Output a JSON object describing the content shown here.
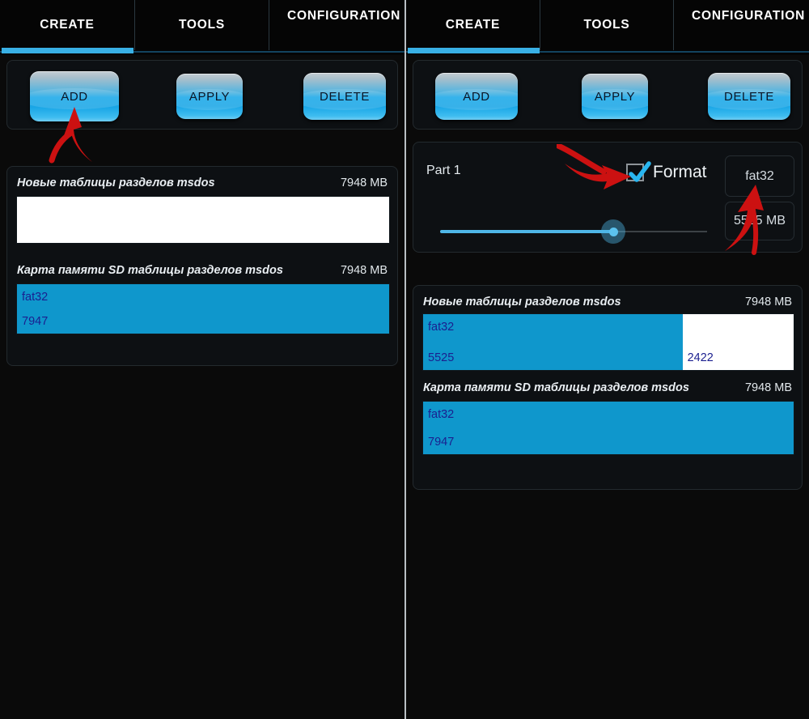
{
  "app": {
    "accent_blue": "#39b0e5",
    "bar_blue": "#0f97cc",
    "free_white": "#ffffff",
    "arrow_red": "#cc1111"
  },
  "tabs": [
    {
      "id": "create",
      "label": "CREATE",
      "active": true
    },
    {
      "id": "tools",
      "label": "TOOLS",
      "active": false
    },
    {
      "id": "configuration",
      "label": "CONFIGURATION",
      "active": false
    }
  ],
  "toolbar": {
    "add_label": "ADD",
    "apply_label": "APPLY",
    "delete_label": "DELETE"
  },
  "left_panel": {
    "devices": [
      {
        "name": "Новые таблицы разделов msdos",
        "size": "7948 MB",
        "segments": [
          {
            "type": "free",
            "fs": "",
            "mb": "",
            "percent": 100
          }
        ]
      },
      {
        "name": "Карта памяти SD таблицы разделов msdos",
        "size": "7948 MB",
        "segments": [
          {
            "type": "used",
            "fs": "fat32",
            "mb": "7947",
            "percent": 100
          }
        ]
      }
    ]
  },
  "right_panel": {
    "part_editor": {
      "title": "Part 1",
      "format_label": "Format",
      "format_checked": true,
      "filesystem": "fat32",
      "size_value": "5525 MB",
      "slider_percent": 65
    },
    "devices": [
      {
        "name": "Новые таблицы разделов msdos",
        "size": "7948 MB",
        "segments": [
          {
            "type": "used",
            "fs": "fat32",
            "mb": "5525",
            "percent": 70
          },
          {
            "type": "free",
            "fs": "",
            "mb": "2422",
            "percent": 30
          }
        ]
      },
      {
        "name": "Карта памяти SD таблицы разделов msdos",
        "size": "7948 MB",
        "segments": [
          {
            "type": "used",
            "fs": "fat32",
            "mb": "7947",
            "percent": 100
          }
        ]
      }
    ]
  },
  "annotations": [
    {
      "id": "arrow-to-add",
      "target": "add-button"
    },
    {
      "id": "arrow-to-format-checkbox",
      "target": "format-checkbox"
    },
    {
      "id": "arrow-to-filesystem",
      "target": "filesystem-select"
    }
  ]
}
